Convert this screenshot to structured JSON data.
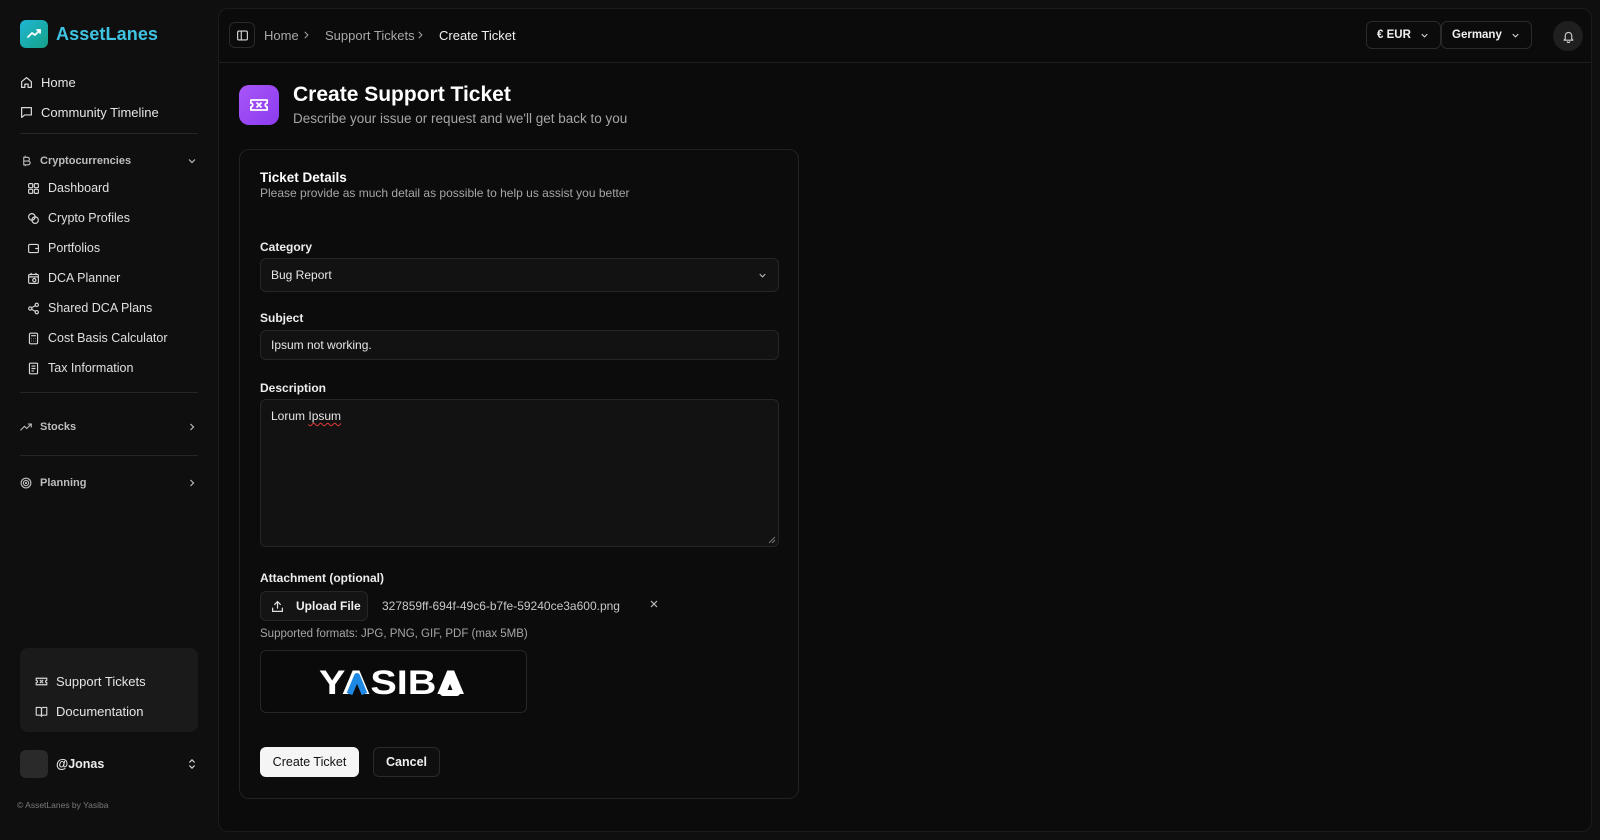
{
  "brand": {
    "name": "AssetLanes"
  },
  "sidebar": {
    "top_items": [
      {
        "label": "Home",
        "icon": "home-icon"
      },
      {
        "label": "Community Timeline",
        "icon": "message-square-icon"
      }
    ],
    "groups": [
      {
        "label": "Cryptocurrencies",
        "icon": "bitcoin-icon",
        "expanded": true,
        "items": [
          {
            "label": "Dashboard",
            "icon": "layout-grid-icon"
          },
          {
            "label": "Crypto Profiles",
            "icon": "coins-icon"
          },
          {
            "label": "Portfolios",
            "icon": "wallet-icon"
          },
          {
            "label": "DCA Planner",
            "icon": "calendar-clock-icon"
          },
          {
            "label": "Shared DCA Plans",
            "icon": "share-icon"
          },
          {
            "label": "Cost Basis Calculator",
            "icon": "calculator-icon"
          },
          {
            "label": "Tax Information",
            "icon": "receipt-icon"
          }
        ]
      },
      {
        "label": "Stocks",
        "icon": "trending-up-icon",
        "expanded": false
      },
      {
        "label": "Planning",
        "icon": "target-icon",
        "expanded": false
      }
    ],
    "bottom_items": [
      {
        "label": "Support Tickets",
        "icon": "ticket-icon"
      },
      {
        "label": "Documentation",
        "icon": "book-open-icon"
      }
    ],
    "user": {
      "name": "@Jonas"
    },
    "copyright": "© AssetLanes by Yasiba"
  },
  "header": {
    "breadcrumb": [
      "Home",
      "Support Tickets",
      "Create Ticket"
    ],
    "currency": "€ EUR",
    "country": "Germany"
  },
  "page": {
    "title": "Create Support Ticket",
    "subtitle": "Describe your issue or request and we'll get back to you"
  },
  "form": {
    "title": "Ticket Details",
    "description": "Please provide as much detail as possible to help us assist you better",
    "category": {
      "label": "Category",
      "value": "Bug Report"
    },
    "subject": {
      "label": "Subject",
      "value": "Ipsum not working."
    },
    "body": {
      "label": "Description",
      "value_word1": "Lorum",
      "value_word2": "Ipsum"
    },
    "attachment": {
      "label": "Attachment (optional)",
      "upload_label": "Upload File",
      "filename": "327859ff-694f-49c6-b7fe-59240ce3a600.png",
      "formats": "Supported formats: JPG, PNG, GIF, PDF (max 5MB)",
      "preview_logo": "YASIBA"
    },
    "submit_label": "Create Ticket",
    "cancel_label": "Cancel"
  },
  "colors": {
    "brand": "#3fc3e3",
    "page_icon": "#a855f7",
    "primary_button": "#f5f5f5",
    "logo_blue": "#1e88e5"
  }
}
